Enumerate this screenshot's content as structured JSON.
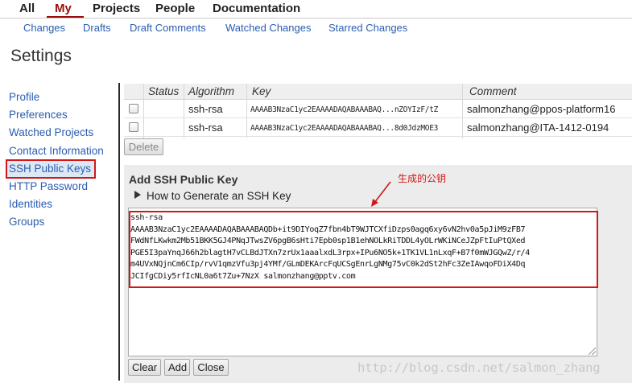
{
  "topnav": {
    "items": [
      {
        "label": "All",
        "active": false
      },
      {
        "label": "My",
        "active": true
      },
      {
        "label": "Projects",
        "active": false
      },
      {
        "label": "People",
        "active": false
      },
      {
        "label": "Documentation",
        "active": false
      }
    ]
  },
  "subnav": {
    "items": [
      "Changes",
      "Drafts",
      "Draft Comments",
      "Watched Changes",
      "Starred Changes"
    ]
  },
  "page_title": "Settings",
  "sidebar": {
    "items": [
      "Profile",
      "Preferences",
      "Watched Projects",
      "Contact Information",
      "SSH Public Keys",
      "HTTP Password",
      "Identities",
      "Groups"
    ],
    "active_index": 4
  },
  "keys_table": {
    "headers": [
      "Status",
      "Algorithm",
      "Key",
      "Comment"
    ],
    "rows": [
      {
        "algorithm": "ssh-rsa",
        "key": "AAAAB3NzaC1yc2EAAAADAQABAAABAQ...nZOYIzF/tZ",
        "comment": "salmonzhang@ppos-platform16"
      },
      {
        "algorithm": "ssh-rsa",
        "key": "AAAAB3NzaC1yc2EAAAADAQABAAABAQ...8d0JdzMOE3",
        "comment": "salmonzhang@ITA-1412-0194"
      }
    ],
    "delete_label": "Delete"
  },
  "add_key": {
    "title": "Add SSH Public Key",
    "howto_label": "How to Generate an SSH Key",
    "value": "ssh-rsa\nAAAAB3NzaC1yc2EAAAADAQABAAABAQDb+it9DIYoqZ7fbn4bT9WJTCXfiDzps0agq6xy6vN2hv0a5pJiM9zFB7\nFWdNfLKwkm2Mb51BKK5GJ4PNqJTwsZV6pgB6sHti7Epb0sp1B1ehNOLkRiTDDL4yOLrWKiNCeJZpFtIuPtQXed\nPGE5I3paYnqJ66h2blagtH7vCLBdJTXn7zrUx1aaalxdL3rpx+IPu6NO5k+1TK1VL1nLxqF+B7f0mWJGQwZ/r/4\nm4UVxNQjnCm6CIp/rvV1qmzVfu3pj4YMf/GLmDEKArcFqUCSgEnrLgNMg75vC0k2dSt2hFc3ZeIAwqoFDiX4Dq\nJCIfgCDiy5rfIcNL0a6t7Zu+7NzX salmonzhang@pptv.com",
    "clear_label": "Clear",
    "add_label": "Add",
    "close_label": "Close"
  },
  "annotation": "生成的公钥",
  "watermark": "http://blog.csdn.net/salmon_zhang",
  "colors": {
    "accent": "#9c0d0d",
    "link": "#2a5db0",
    "highlight_box": "#d01818"
  }
}
